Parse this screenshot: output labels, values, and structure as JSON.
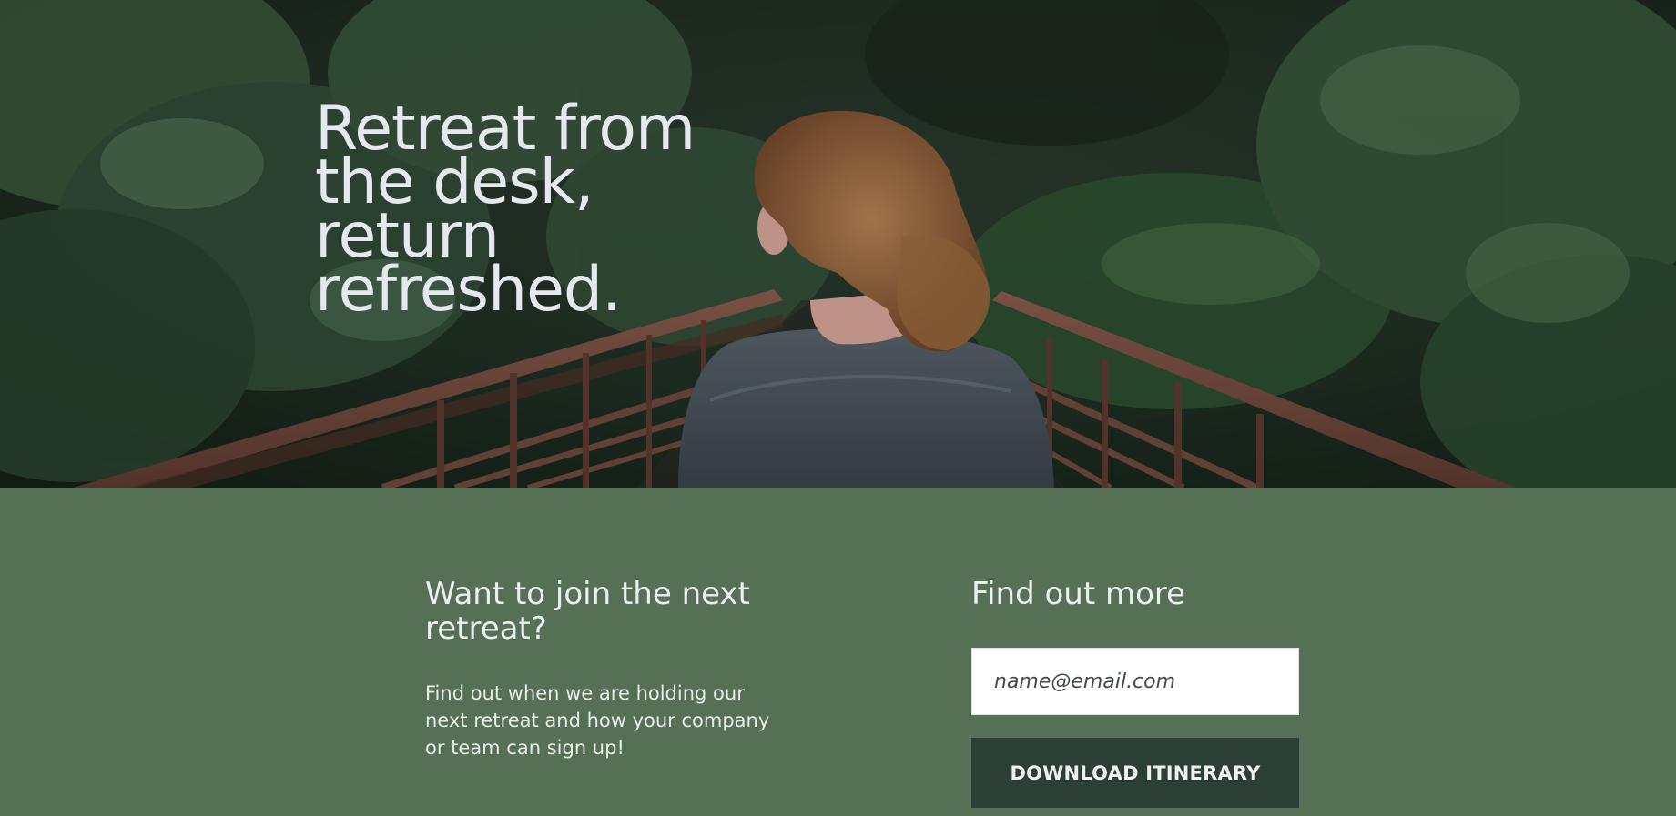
{
  "hero": {
    "title": "Retreat from the desk, return refreshed."
  },
  "join": {
    "heading": "Want to join the next retreat?",
    "text": "Find out when we are holding our next retreat and how your company or team can sign up!"
  },
  "signup": {
    "heading": "Find out more",
    "email_placeholder": "name@email.com",
    "button_label": "DOWNLOAD ITINERARY"
  },
  "colors": {
    "section_green": "#557055",
    "button_dark": "#2b3f36",
    "heading_text": "#eceef2"
  }
}
